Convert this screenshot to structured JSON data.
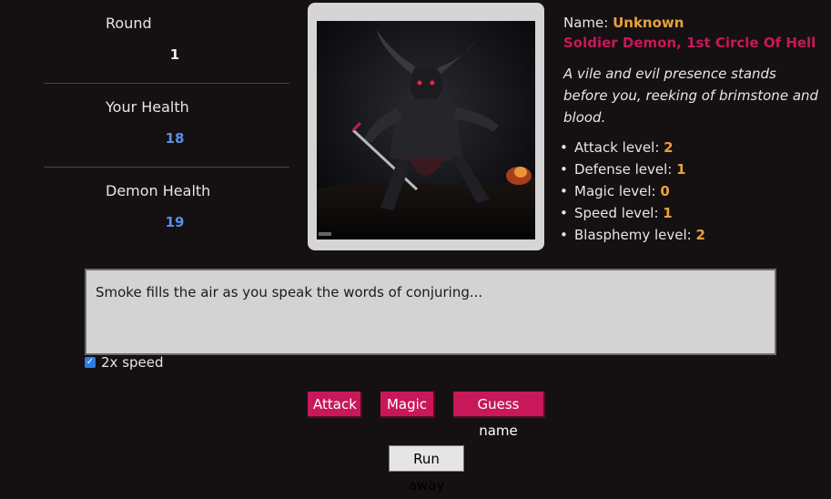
{
  "stats": {
    "round_label": "Round",
    "round_value": "1",
    "health_label": "Your Health",
    "health_value": "18",
    "demon_health_label": "Demon Health",
    "demon_health_value": "19"
  },
  "demon": {
    "name_label": "Name:",
    "name_value": "Unknown",
    "title": "Soldier Demon, 1st Circle Of Hell",
    "description": "A vile and evil presence stands before you, reeking of brimstone and blood.",
    "levels": [
      {
        "label": "Attack level:",
        "value": "2"
      },
      {
        "label": "Defense level:",
        "value": "1"
      },
      {
        "label": "Magic level:",
        "value": "0"
      },
      {
        "label": "Speed level:",
        "value": "1"
      },
      {
        "label": "Blasphemy level:",
        "value": "2"
      }
    ]
  },
  "log": {
    "text": "Smoke fills the air as you speak the words of conjuring..."
  },
  "options": {
    "speed_label": "2x speed",
    "speed_checked": true
  },
  "actions": {
    "attack": "Attack",
    "magic": "Magic",
    "guess_name": "Guess name",
    "run_away": "Run away"
  },
  "colors": {
    "background": "#151011",
    "accent_red": "#c8185a",
    "accent_gold": "#e8a13a",
    "accent_blue": "#5b8fe6"
  }
}
